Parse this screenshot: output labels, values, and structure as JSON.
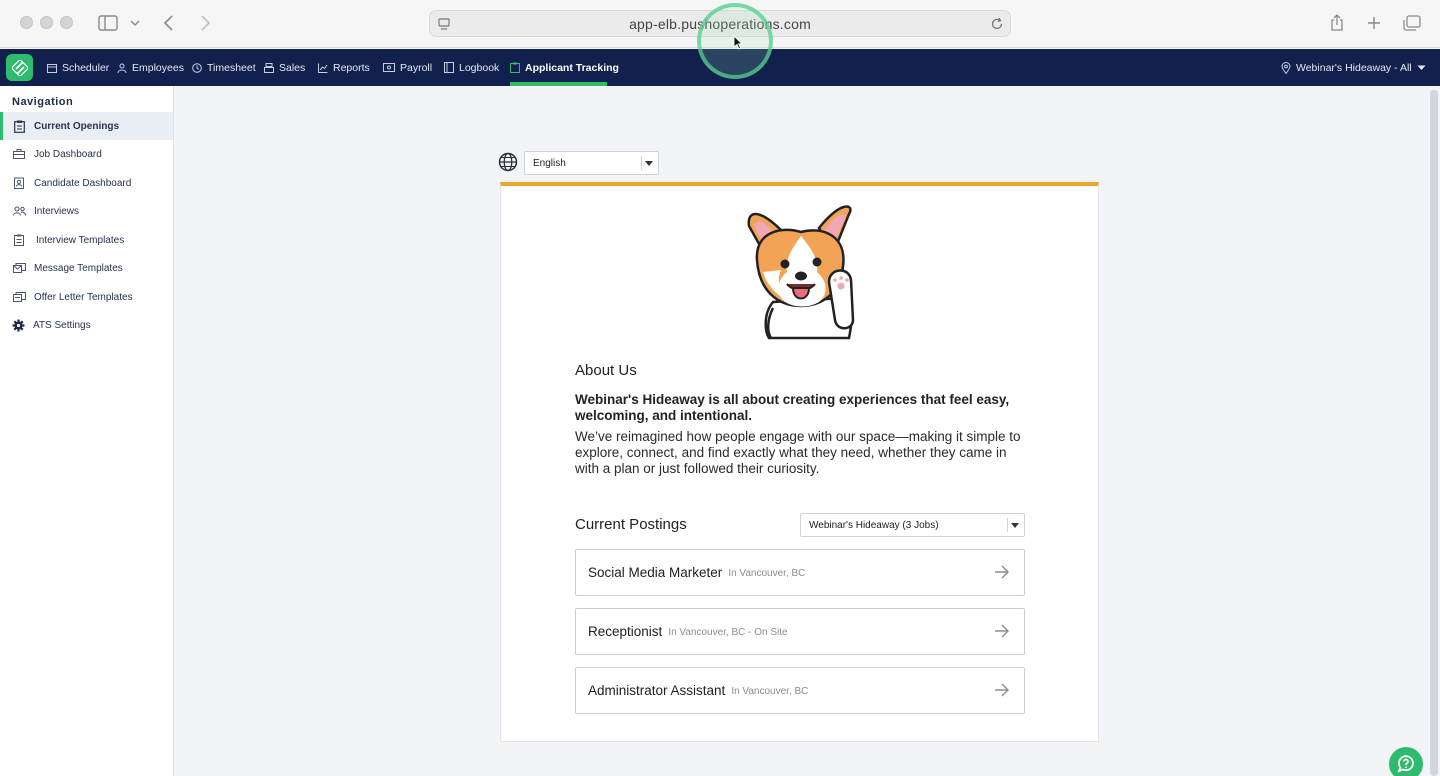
{
  "browser": {
    "url": "app-elb.pushoperations.com"
  },
  "topnav": {
    "items": [
      {
        "label": "Scheduler",
        "icon": "calendar-icon"
      },
      {
        "label": "Employees",
        "icon": "person-icon"
      },
      {
        "label": "Timesheet",
        "icon": "clock-icon"
      },
      {
        "label": "Sales",
        "icon": "register-icon"
      },
      {
        "label": "Reports",
        "icon": "chart-icon"
      },
      {
        "label": "Payroll",
        "icon": "money-icon"
      },
      {
        "label": "Logbook",
        "icon": "book-icon"
      },
      {
        "label": "Applicant Tracking",
        "icon": "clipboard-icon",
        "active": true
      }
    ],
    "location": "Webinar's Hideaway - All"
  },
  "sidebar": {
    "title": "Navigation",
    "items": [
      {
        "label": "Current Openings",
        "icon": "clipboard-icon",
        "active": true
      },
      {
        "label": "Job Dashboard",
        "icon": "briefcase-icon"
      },
      {
        "label": "Candidate Dashboard",
        "icon": "badge-icon"
      },
      {
        "label": "Interviews",
        "icon": "people-icon"
      },
      {
        "label": "Interview Templates",
        "icon": "clipboard-list-icon"
      },
      {
        "label": "Message Templates",
        "icon": "message-icon"
      },
      {
        "label": "Offer Letter Templates",
        "icon": "letter-icon"
      },
      {
        "label": "ATS Settings",
        "icon": "gear-icon"
      }
    ]
  },
  "language": {
    "selected": "English"
  },
  "about": {
    "title": "About Us",
    "headline": "Webinar's Hideaway is all about creating experiences that feel easy, welcoming, and intentional.",
    "body": "We’ve reimagined how people engage with our space—making it simple to explore, connect, and find exactly what they need, whether they came in with a plan or just followed their curiosity."
  },
  "postings": {
    "title": "Current Postings",
    "filter": "Webinar's Hideaway (3 Jobs)",
    "jobs": [
      {
        "title": "Social Media Marketer",
        "location": "In Vancouver, BC"
      },
      {
        "title": "Receptionist",
        "location": "In Vancouver, BC - On Site"
      },
      {
        "title": "Administrator Assistant",
        "location": "In Vancouver, BC"
      }
    ]
  },
  "colors": {
    "nav_bg": "#12204d",
    "brand_green": "#2dbb6e",
    "card_accent": "#f0a431"
  }
}
